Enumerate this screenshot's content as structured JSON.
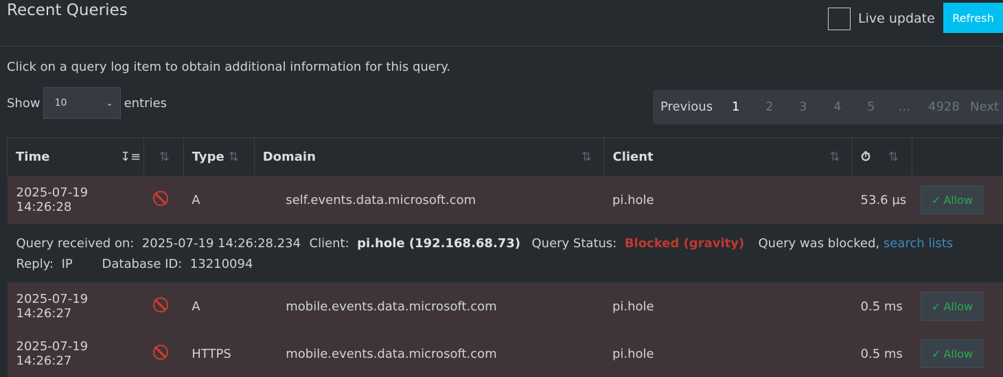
{
  "header": {
    "title": "Recent Queries",
    "live_update_label": "Live update",
    "refresh_label": "Refresh"
  },
  "hint": "Click on a query log item to obtain additional information for this query.",
  "length": {
    "show_label": "Show",
    "value": "10",
    "entries_label": "entries"
  },
  "pager": {
    "previous": "Previous",
    "pages": [
      "1",
      "2",
      "3",
      "4",
      "5",
      "…",
      "4928"
    ],
    "next": "Next"
  },
  "table": {
    "headers": {
      "time": "Time",
      "type": "Type",
      "domain": "Domain",
      "client": "Client"
    },
    "rows": [
      {
        "time": "2025-07-19 14:26:28",
        "type": "A",
        "domain": "self.events.data.microsoft.com",
        "client": "pi.hole",
        "duration": "53.6 µs",
        "action": "Allow"
      },
      {
        "time": "2025-07-19 14:26:27",
        "type": "A",
        "domain": "mobile.events.data.microsoft.com",
        "client": "pi.hole",
        "duration": "0.5 ms",
        "action": "Allow"
      },
      {
        "time": "2025-07-19 14:26:27",
        "type": "HTTPS",
        "domain": "mobile.events.data.microsoft.com",
        "client": "pi.hole",
        "duration": "0.5 ms",
        "action": "Allow"
      }
    ],
    "detail": {
      "received_label": "Query received on:",
      "received_value": "2025-07-19 14:26:28.234",
      "client_label": "Client:",
      "client_value": "pi.hole (192.168.68.73)",
      "status_label": "Query Status:",
      "status_value": "Blocked (gravity)",
      "blocked_text": "Query was blocked,",
      "search_link": "search lists",
      "reply_label": "Reply:",
      "reply_value": "IP",
      "dbid_label": "Database ID:",
      "dbid_value": "13210094"
    }
  },
  "colors": {
    "accent": "#00c0ef",
    "blocked": "#c0392b",
    "allow": "#2fa84f",
    "link": "#3c8dbc"
  }
}
